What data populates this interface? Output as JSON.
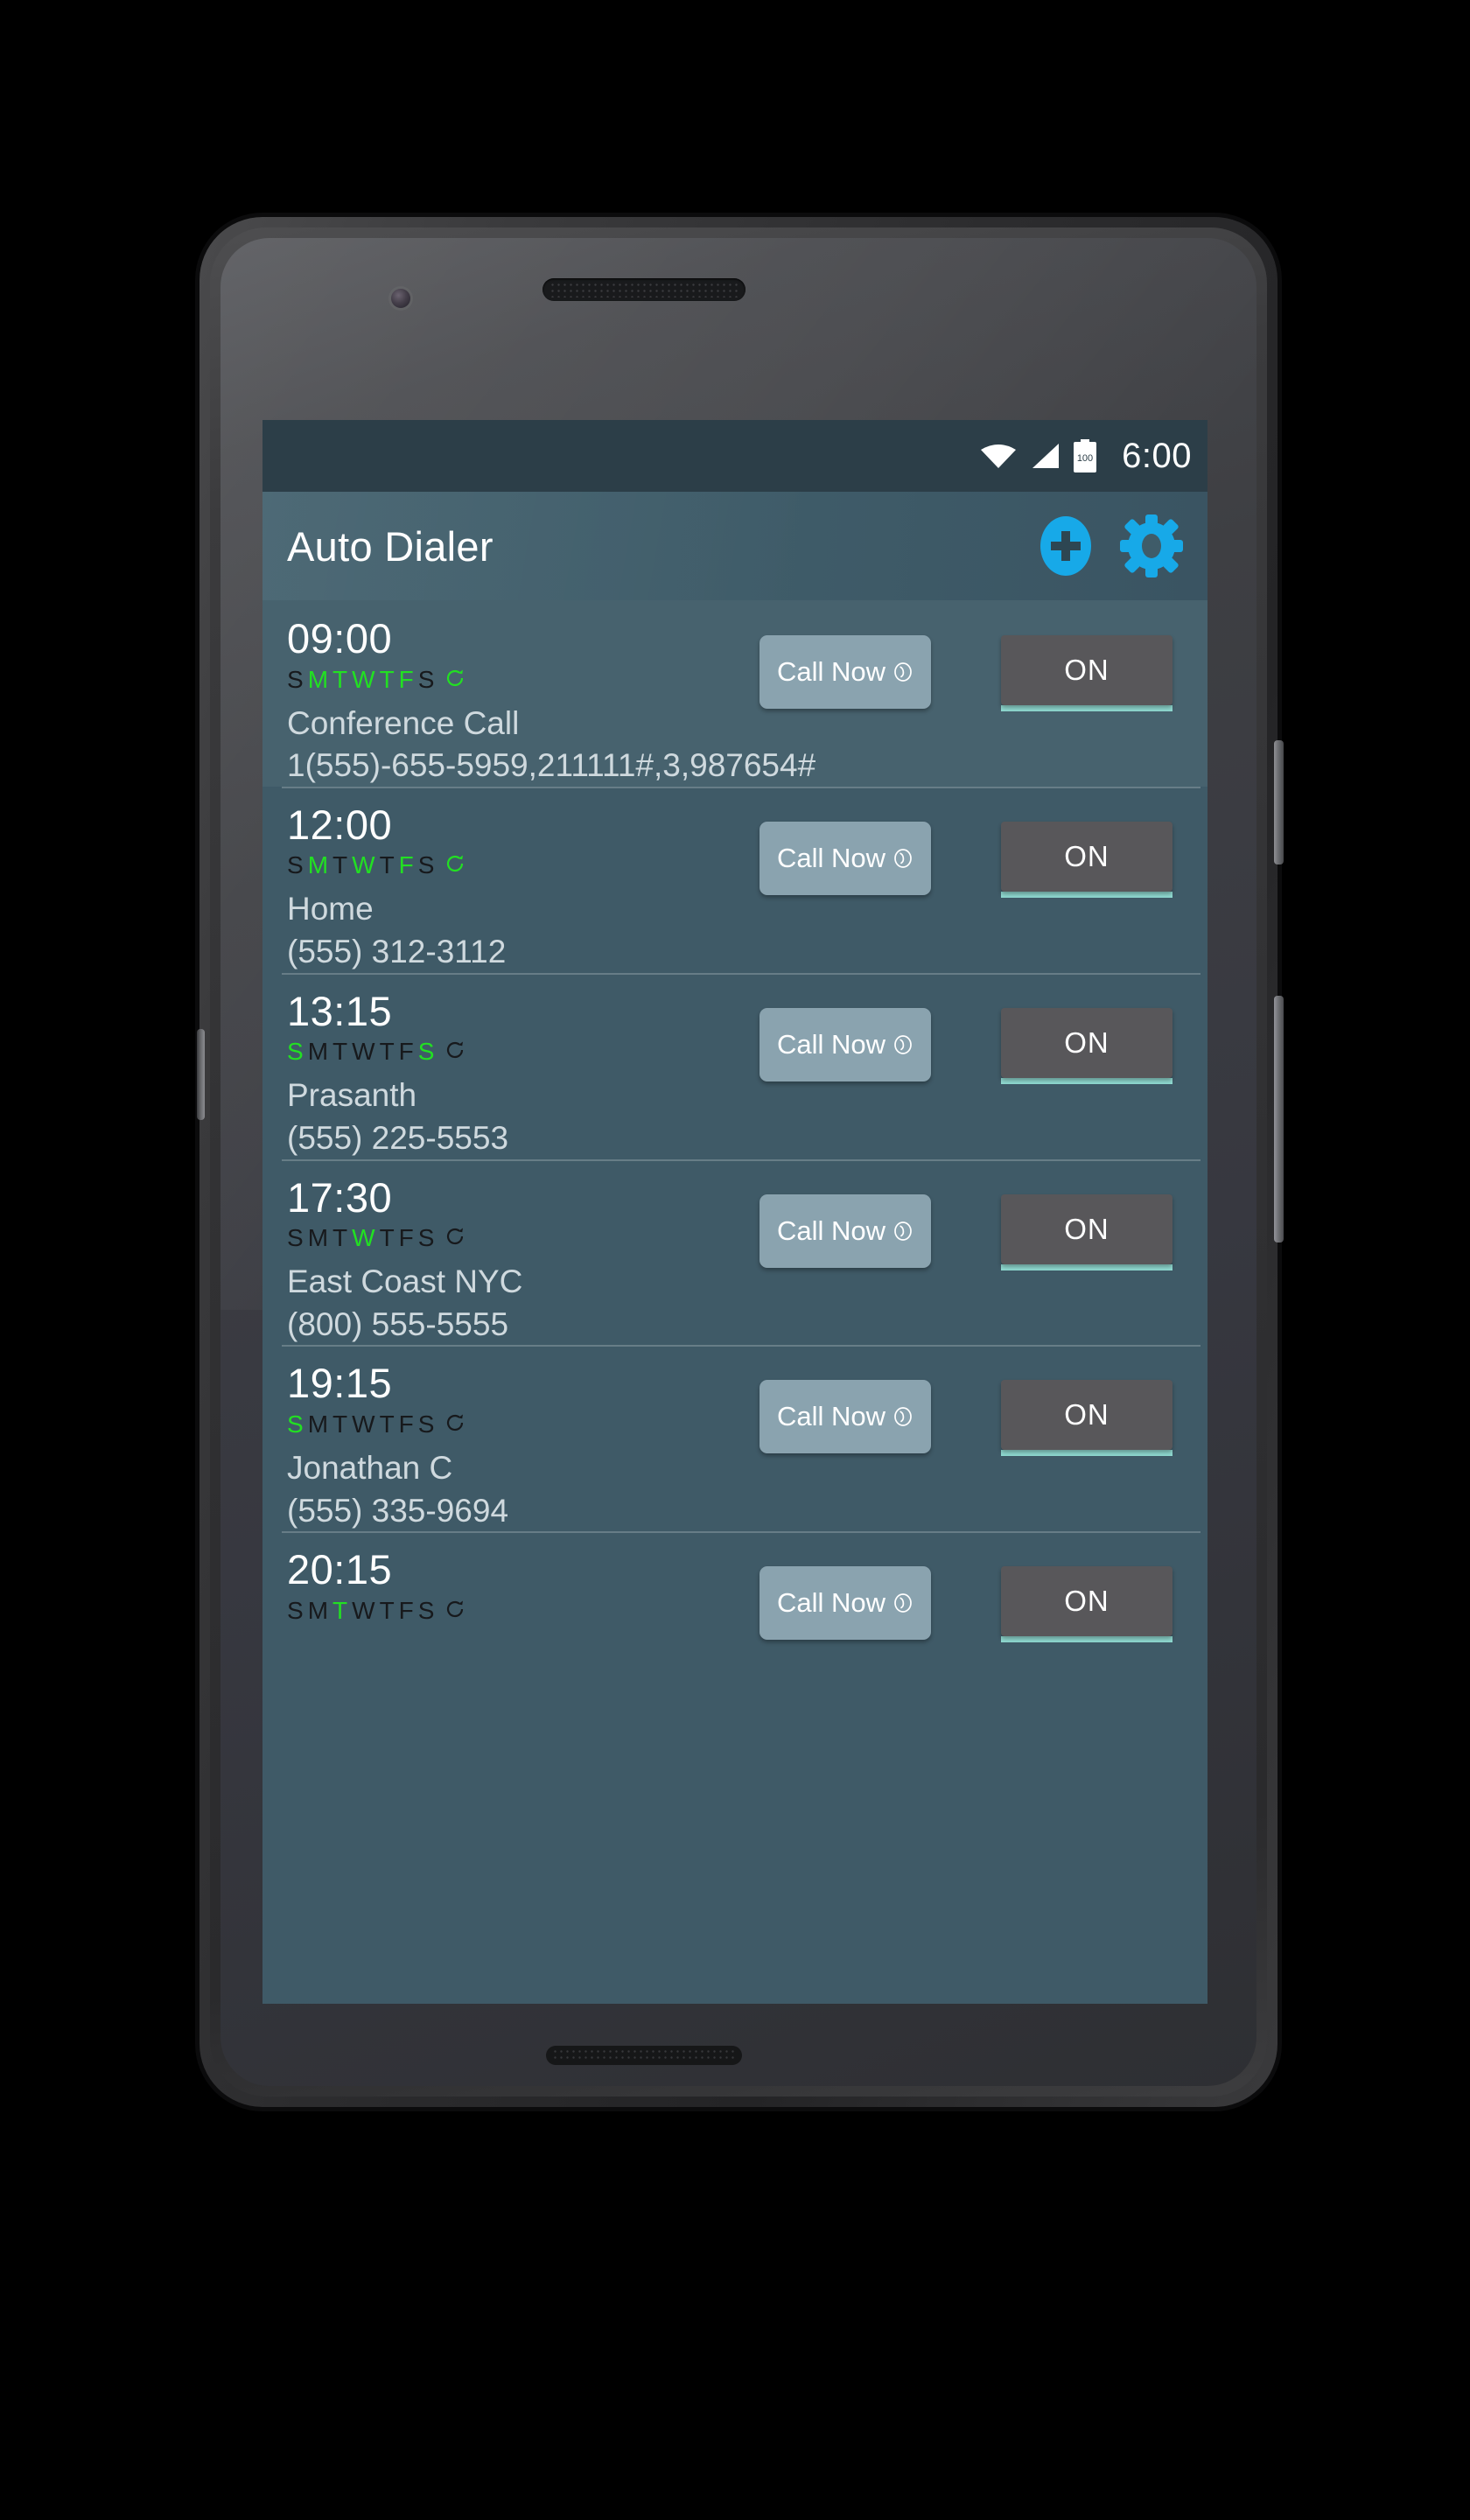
{
  "status_bar": {
    "time": "6:00",
    "battery_level": "100",
    "icons": [
      "wifi-icon",
      "cellular-signal-icon",
      "battery-icon"
    ]
  },
  "app_bar": {
    "title": "Auto Dialer",
    "add_icon": "add-circle-icon",
    "settings_icon": "gear-icon"
  },
  "common": {
    "call_now_label": "Call Now",
    "call_icon": "phone-icon",
    "toggle_on_label": "ON",
    "repeat_icon": "repeat-icon",
    "day_initials": [
      "S",
      "M",
      "T",
      "W",
      "T",
      "F",
      "S"
    ]
  },
  "colors": {
    "accent_blue": "#17a9e8",
    "day_on_green": "#22e022",
    "day_off_dark": "#17191c",
    "toggle_underline_teal": "#8fd9d0",
    "screen_bg": "#3f5a67",
    "appbar_bg": "#3f5c69",
    "statusbar_bg": "#2c3e48",
    "call_btn_bg": "#8aa3af",
    "toggle_btn_bg": "#58575a"
  },
  "alarms": [
    {
      "time": "09:00",
      "days_active": [
        false,
        true,
        true,
        true,
        true,
        true,
        false
      ],
      "repeat_active": true,
      "label": "Conference Call",
      "number": "1(555)-655-5959,211111#,3,987654#",
      "call_label": "Call Now",
      "toggle_state": "ON",
      "highlighted": true
    },
    {
      "time": "12:00",
      "days_active": [
        false,
        true,
        false,
        true,
        false,
        true,
        false
      ],
      "repeat_active": true,
      "label": "Home",
      "number": "(555) 312-3112",
      "call_label": "Call Now",
      "toggle_state": "ON",
      "highlighted": false
    },
    {
      "time": "13:15",
      "days_active": [
        true,
        false,
        false,
        false,
        false,
        false,
        true
      ],
      "repeat_active": false,
      "label": "Prasanth",
      "number": "(555) 225-5553",
      "call_label": "Call Now",
      "toggle_state": "ON",
      "highlighted": false
    },
    {
      "time": "17:30",
      "days_active": [
        false,
        false,
        false,
        true,
        false,
        false,
        false
      ],
      "repeat_active": false,
      "label": "East Coast NYC",
      "number": "(800) 555-5555",
      "call_label": "Call Now",
      "toggle_state": "ON",
      "highlighted": false
    },
    {
      "time": "19:15",
      "days_active": [
        true,
        false,
        false,
        false,
        false,
        false,
        false
      ],
      "repeat_active": false,
      "label": "Jonathan C",
      "number": "(555) 335-9694",
      "call_label": "Call Now",
      "toggle_state": "ON",
      "highlighted": false
    },
    {
      "time": "20:15",
      "days_active": [
        false,
        false,
        true,
        false,
        false,
        false,
        false
      ],
      "repeat_active": false,
      "label": "",
      "number": "",
      "call_label": "Call Now",
      "toggle_state": "ON",
      "highlighted": false
    }
  ],
  "nav_bar": {
    "back_icon": "back-triangle-icon",
    "home_icon": "home-circle-icon",
    "recents_icon": "recents-square-icon"
  }
}
